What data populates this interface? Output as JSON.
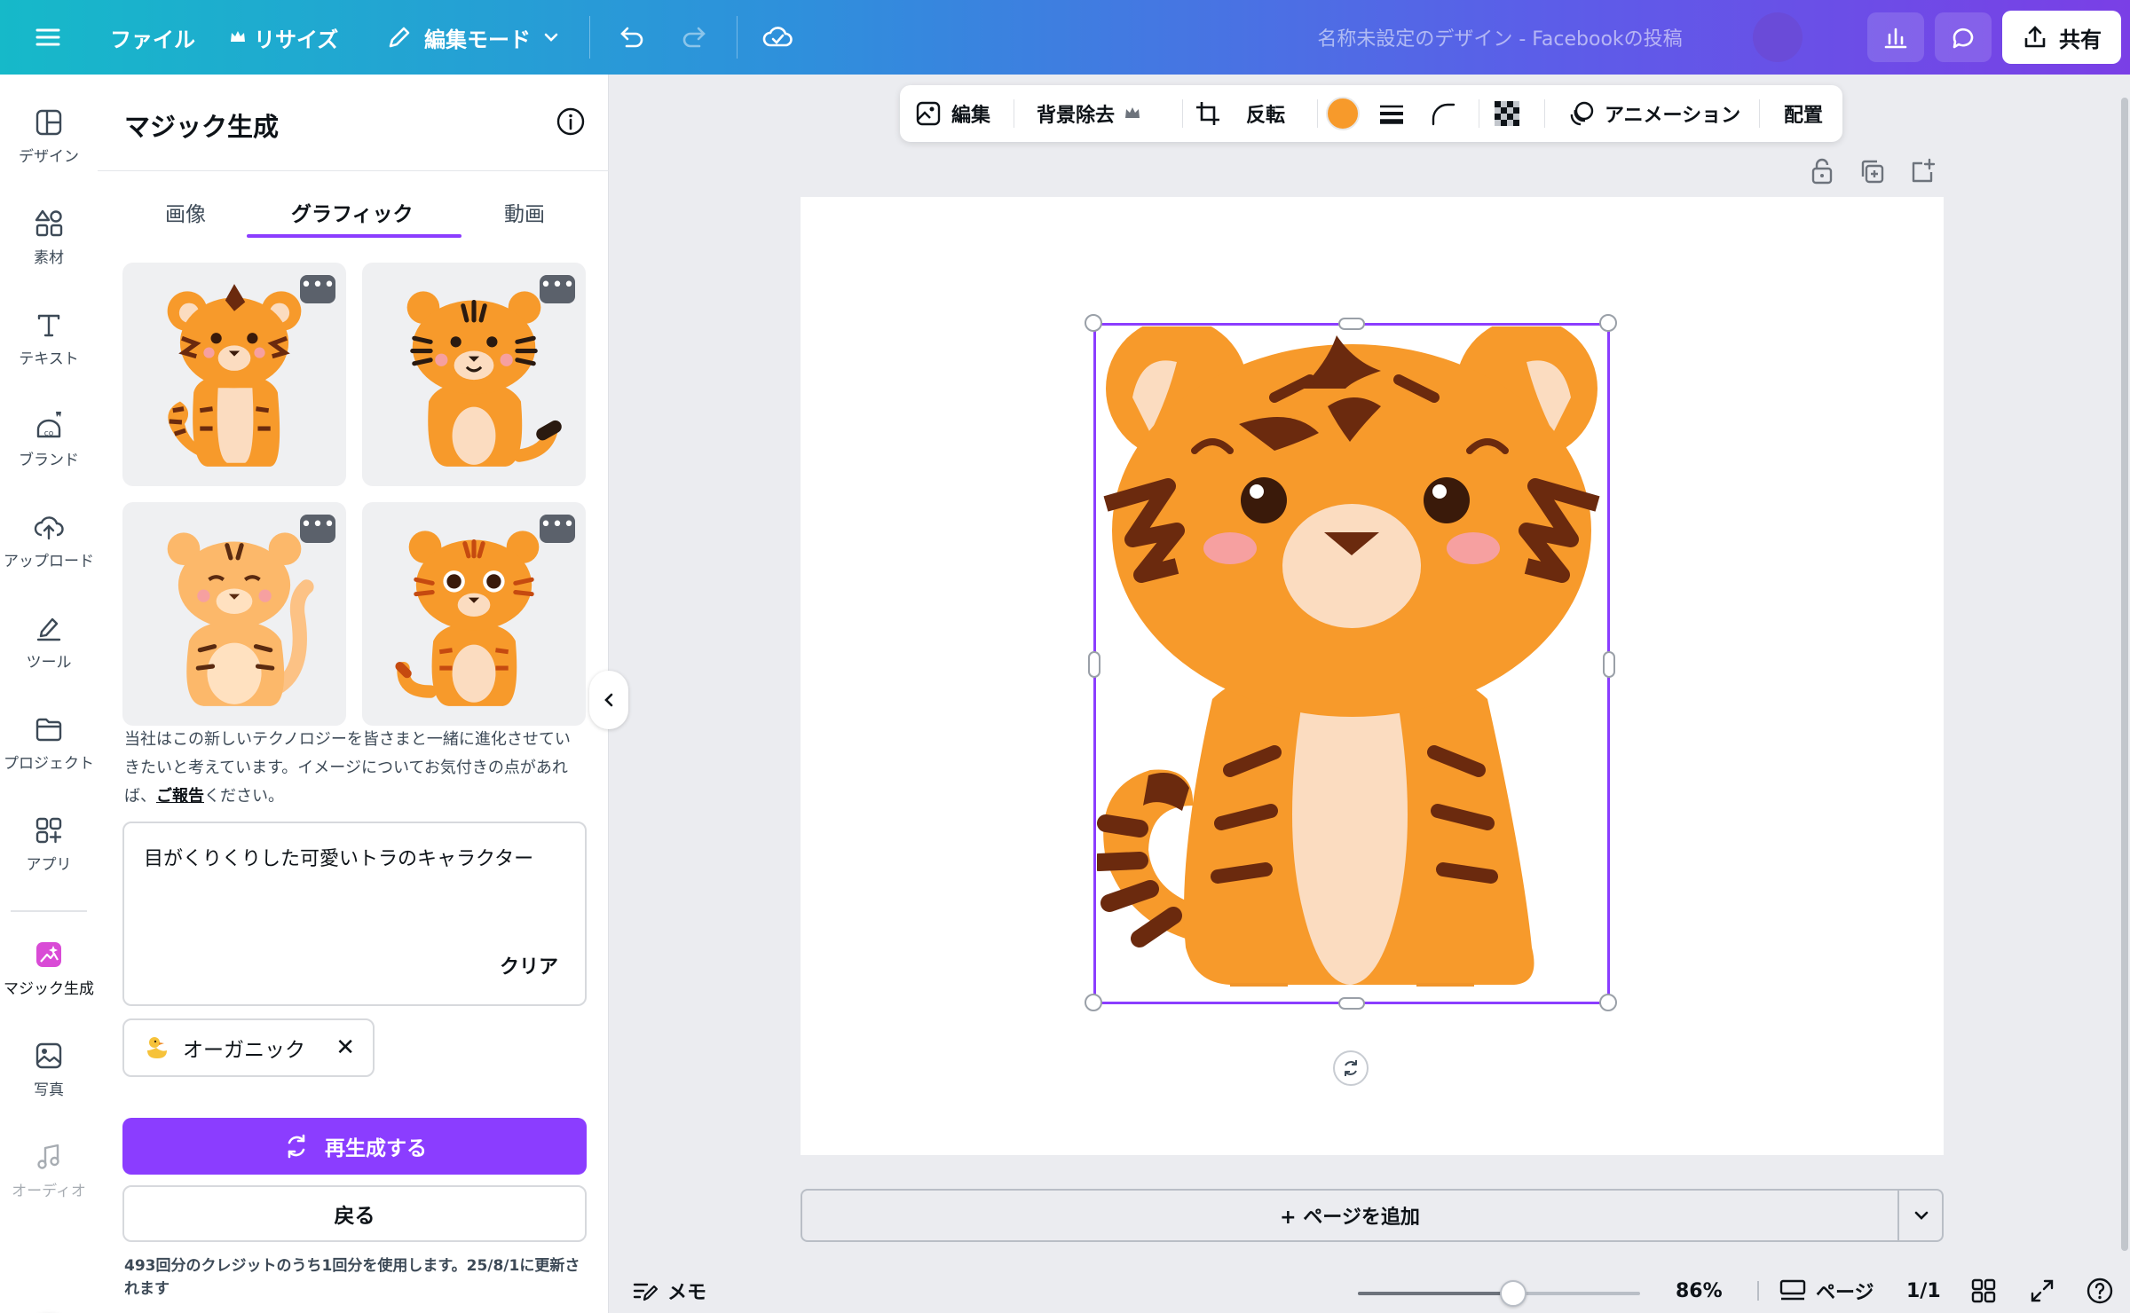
{
  "topbar": {
    "file": "ファイル",
    "resize": "リサイズ",
    "edit_mode": "編集モード",
    "doc_title": "名称未設定のデザイン - Facebookの投稿",
    "share": "共有"
  },
  "rail": {
    "items": [
      {
        "label": "デザイン",
        "icon": "layout-icon"
      },
      {
        "label": "素材",
        "icon": "shapes-icon"
      },
      {
        "label": "テキスト",
        "icon": "text-icon"
      },
      {
        "label": "ブランド",
        "icon": "brand-icon"
      },
      {
        "label": "アップロード",
        "icon": "upload-cloud-icon"
      },
      {
        "label": "ツール",
        "icon": "pen-tool-icon"
      },
      {
        "label": "プロジェクト",
        "icon": "folder-icon"
      },
      {
        "label": "アプリ",
        "icon": "apps-icon"
      },
      {
        "label": "マジック生成",
        "icon": "magic-media-icon"
      },
      {
        "label": "写真",
        "icon": "photo-icon"
      },
      {
        "label": "オーディオ",
        "icon": "music-note-icon"
      }
    ]
  },
  "panel": {
    "title": "マジック生成",
    "tabs": [
      {
        "label": "画像",
        "active": false
      },
      {
        "label": "グラフィック",
        "active": true
      },
      {
        "label": "動画",
        "active": false
      }
    ],
    "results": [
      {
        "name": "tiger-result-1"
      },
      {
        "name": "tiger-result-2"
      },
      {
        "name": "tiger-result-3"
      },
      {
        "name": "tiger-result-4"
      }
    ],
    "more_label": "•••",
    "notice_pre": "当社はこの新しいテクノロジーを皆さまと一緒に進化させていきたいと考えています。イメージについてお気付きの点があれば、",
    "notice_link": "ご報告",
    "notice_post": "ください。",
    "prompt_value": "目がくりくりした可愛いトラのキャラクター",
    "clear": "クリア",
    "style_chip": "オーガニック",
    "regenerate": "再生成する",
    "back": "戻る",
    "credit_note": "493回分のクレジットのうち1回分を使用します。25/8/1に更新されます"
  },
  "context_toolbar": {
    "edit": "編集",
    "remove_bg": "背景除去",
    "flip": "反転",
    "animation": "アニメーション",
    "position": "配置",
    "color_swatch": "#f79a2b"
  },
  "canvas": {
    "add_page": "+ ページを追加"
  },
  "footer": {
    "notes": "メモ",
    "zoom": "86%",
    "zoom_level": 0.55,
    "pages": "ページ",
    "page_count": "1/1"
  },
  "colors": {
    "accent": "#8b3dff",
    "tiger_orange": "#f79a2b",
    "tiger_stripe": "#6b2a0e",
    "tiger_belly": "#fbdcc0"
  }
}
